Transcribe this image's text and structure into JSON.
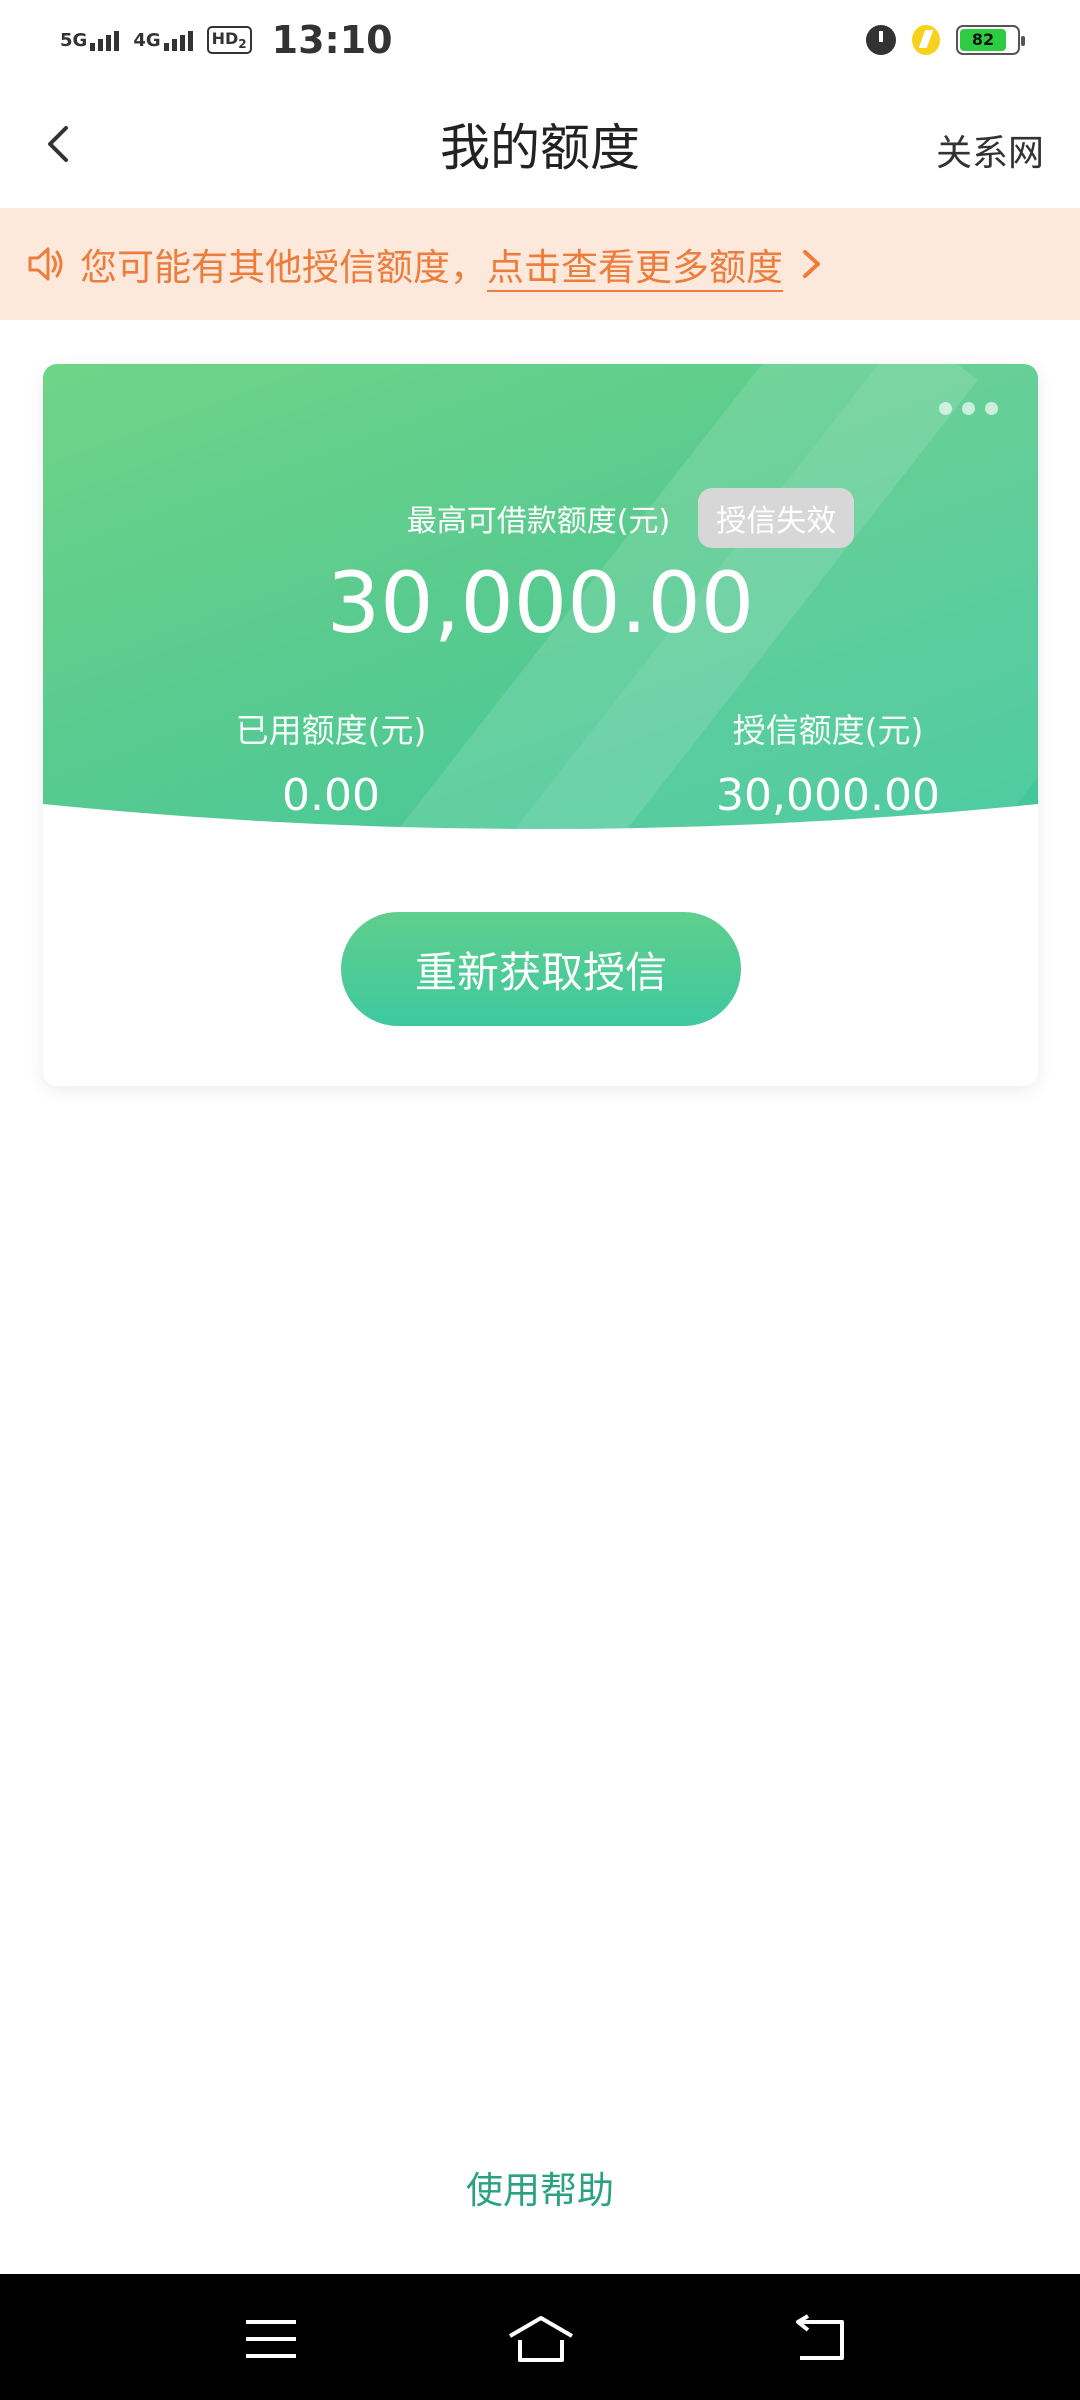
{
  "status_bar": {
    "network1": "5G",
    "network2": "4G",
    "hd_label": "HD",
    "hd_sub": "2",
    "time": "13:10",
    "battery_level": 82,
    "battery_text": "82"
  },
  "header": {
    "title": "我的额度",
    "right_link": "关系网"
  },
  "notice": {
    "text": "您可能有其他授信额度，",
    "link_text": "点击查看更多额度"
  },
  "card": {
    "max_label": "最高可借款额度(元)",
    "status_badge": "授信失效",
    "max_amount": "30,000.00",
    "used_label": "已用额度(元)",
    "used_value": "0.00",
    "credit_label": "授信额度(元)",
    "credit_value": "30,000.00",
    "action_label": "重新获取授信"
  },
  "footer": {
    "help_label": "使用帮助"
  },
  "colors": {
    "accent_green": "#4fcb92",
    "notice_orange": "#ec7d3d",
    "notice_bg": "#fde9dc",
    "help_green": "#2aa27f"
  },
  "icons": [
    "back-icon",
    "speaker-icon",
    "chevron-right-icon",
    "more-icon",
    "menu-icon",
    "home-icon",
    "back-nav-icon"
  ]
}
